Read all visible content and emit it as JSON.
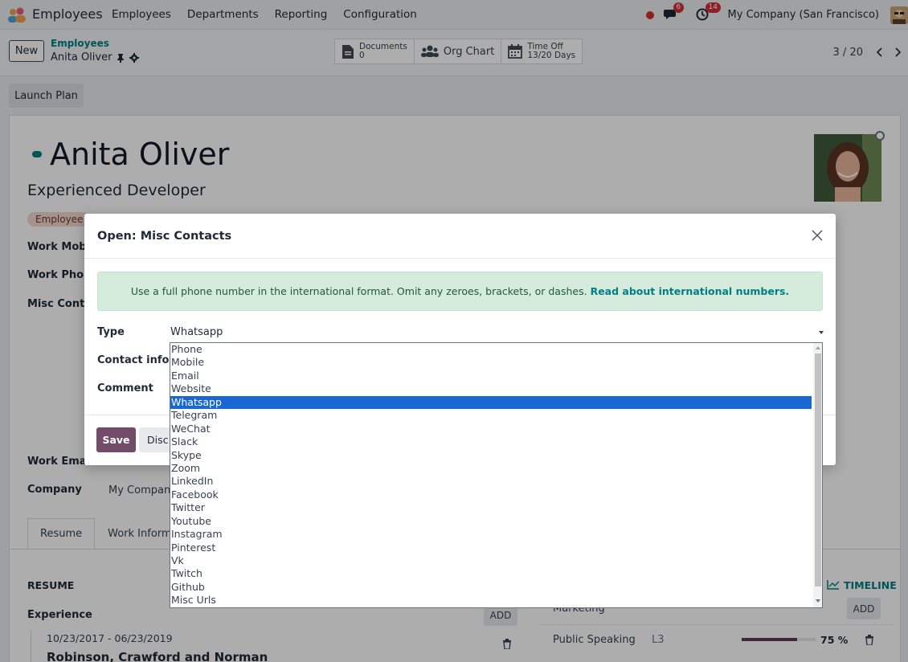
{
  "navbar": {
    "app_title": "Employees",
    "menu": [
      "Employees",
      "Departments",
      "Reporting",
      "Configuration"
    ],
    "chat_count": "6",
    "activity_count": "14",
    "company": "My Company (San Francisco)"
  },
  "control_panel": {
    "new_label": "New",
    "breadcrumb_parent": "Employees",
    "breadcrumb_current": "Anita Oliver",
    "smart_buttons": {
      "documents_label": "Documents",
      "documents_count": "0",
      "org_chart_label": "Org Chart",
      "time_off_label": "Time Off",
      "time_off_value": "13/20 Days"
    },
    "pager": "3 / 20"
  },
  "actions": {
    "launch_plan": "Launch Plan"
  },
  "employee": {
    "name": "Anita Oliver",
    "job_title": "Experienced Developer",
    "tag": "Employee",
    "fields": {
      "work_mobile": "Work Mobil",
      "work_phone": "Work Phone",
      "misc_contacts": "Misc Conta",
      "work_email": "Work Email",
      "company_label": "Company",
      "company_value": "My Company"
    }
  },
  "tabs": [
    "Resume",
    "Work Informa"
  ],
  "resume": {
    "heading": "RESUME",
    "timeline": "TIMELINE",
    "experience_heading": "Experience",
    "add_label": "ADD",
    "entry_dates": "10/23/2017 - 06/23/2019",
    "entry_company": "Robinson, Crawford and Norman"
  },
  "skills": {
    "category": "Marketing",
    "add_label": "ADD",
    "skill_name": "Public Speaking",
    "skill_level": "L3",
    "skill_progress": 75,
    "skill_progress_label": "75 %"
  },
  "modal": {
    "title": "Open: Misc Contacts",
    "alert_text": "Use a full phone number in the international format. Omit any zeroes, brackets, or dashes.",
    "alert_link": "Read about international numbers.",
    "type_label": "Type",
    "type_value": "Whatsapp",
    "contact_info_label": "Contact info",
    "comment_label": "Comment",
    "save_label": "Save",
    "discard_label": "Disc"
  },
  "dropdown": {
    "options": [
      "Phone",
      "Mobile",
      "Email",
      "Website",
      "Whatsapp",
      "Telegram",
      "WeChat",
      "Slack",
      "Skype",
      "Zoom",
      "LinkedIn",
      "Facebook",
      "Twitter",
      "Youtube",
      "Instagram",
      "Pinterest",
      "Vk",
      "Twitch",
      "Github",
      "Misc Urls"
    ],
    "selected": "Whatsapp"
  },
  "colors": {
    "brand": "#714b67",
    "teal": "#017e84",
    "selected_option": "#1967d2",
    "alert_bg": "#d5ecdd"
  }
}
